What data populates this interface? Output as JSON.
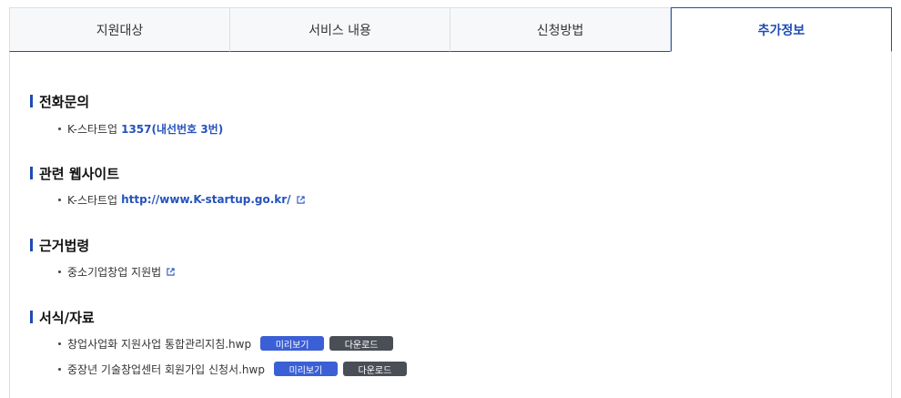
{
  "tabs": [
    {
      "label": "지원대상",
      "active": false
    },
    {
      "label": "서비스 내용",
      "active": false
    },
    {
      "label": "신청방법",
      "active": false
    },
    {
      "label": "추가정보",
      "active": true
    }
  ],
  "sections": {
    "phone": {
      "title": "전화문의",
      "item_label": "K-스타트업",
      "item_value": "1357(내선번호 3번)"
    },
    "website": {
      "title": "관련 웹사이트",
      "item_label": "K-스타트업",
      "item_link": "http://www.K-startup.go.kr/",
      "icon": "external-link-icon"
    },
    "law": {
      "title": "근거법령",
      "item_label": "중소기업창업 지원법",
      "icon": "external-link-icon"
    },
    "forms": {
      "title": "서식/자료",
      "files": [
        {
          "name": "창업사업화 지원사업 통합관리지침.hwp",
          "preview_label": "미리보기",
          "download_label": "다운로드"
        },
        {
          "name": "중장년 기술창업센터 회원가입 신청서.hwp",
          "preview_label": "미리보기",
          "download_label": "다운로드"
        }
      ]
    }
  },
  "colors": {
    "accent": "#1d4cb4",
    "link": "#2452bd",
    "preview_button": "#3b5fd4",
    "download_button": "#4a4e57"
  }
}
